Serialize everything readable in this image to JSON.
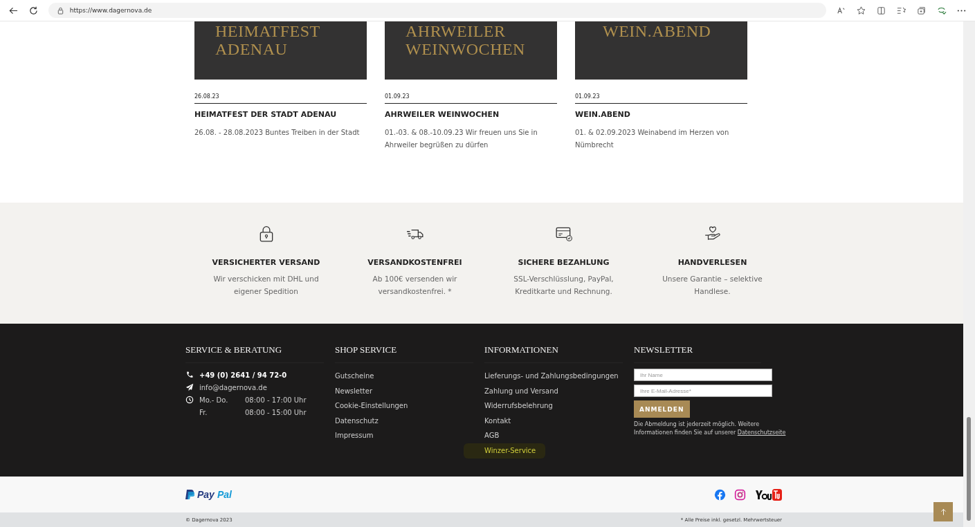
{
  "browser": {
    "url": "https://www.dagernova.de"
  },
  "events": [
    {
      "image_lines": [
        "HEIMATFEST",
        "ADENAU"
      ],
      "date": "26.08.23",
      "title": "HEIMATFEST DER STADT ADENAU",
      "text": "26.08. - 28.08.2023 Buntes Treiben in der Stadt"
    },
    {
      "image_lines": [
        "AHRWEILER",
        "WEINWOCHEN"
      ],
      "date": "01.09.23",
      "title": "AHRWEILER WEINWOCHEN",
      "text": "01.-03. & 08.-10.09.23 Wir freuen uns Sie in Ahrweiler begrüßen zu dürfen"
    },
    {
      "image_lines": [
        "WEIN.ABEND"
      ],
      "date": "01.09.23",
      "title": "WEIN.ABEND",
      "text": "01. & 02.09.2023 Weinabend im Herzen von Nümbrecht"
    }
  ],
  "features": [
    {
      "kind": "lock",
      "title": "VERSICHERTER VERSAND",
      "text": "Wir verschicken mit DHL und eigener Spedition"
    },
    {
      "kind": "truck",
      "title": "VERSANDKOSTENFREI",
      "text": "Ab 100€ versenden wir versandkostenfrei. *"
    },
    {
      "kind": "card",
      "title": "SICHERE BEZAHLUNG",
      "text": "SSL-Verschlüsslung, PayPal, Kreditkarte und Rechnung."
    },
    {
      "kind": "hand",
      "title": "HANDVERLESEN",
      "text": "Unsere Garantie – selektive Handlese."
    }
  ],
  "footer": {
    "service": {
      "title": "SERVICE & BERATUNG",
      "phone": "+49 (0) 2641 / 94 72-0",
      "email": "info@dagernova.de",
      "hours": [
        [
          "Mo.- Do.",
          "08:00 - 17:00 Uhr"
        ],
        [
          "Fr.",
          "08:00 - 15:00 Uhr"
        ]
      ]
    },
    "shop": {
      "title": "SHOP SERVICE",
      "links": [
        {
          "label": "Gutscheine",
          "highlighted": false
        },
        {
          "label": "Newsletter",
          "highlighted": false
        },
        {
          "label": "Cookie-Einstellungen",
          "highlighted": false
        },
        {
          "label": "Datenschutz",
          "highlighted": false
        },
        {
          "label": "Impressum",
          "highlighted": false
        }
      ]
    },
    "info": {
      "title": "INFORMATIONEN",
      "links": [
        {
          "label": "Lieferungs- und Zahlungsbedingungen",
          "highlighted": false
        },
        {
          "label": "Zahlung und Versand",
          "highlighted": false
        },
        {
          "label": "Widerrufsbelehrung",
          "highlighted": false
        },
        {
          "label": "Kontakt",
          "highlighted": false
        },
        {
          "label": "AGB",
          "highlighted": false
        },
        {
          "label": "Winzer-Service",
          "highlighted": true
        }
      ]
    },
    "newsletter": {
      "title": "NEWSLETTER",
      "name_placeholder": "Ihr Name",
      "email_placeholder": "Ihre E-Mail-Adresse*",
      "button": "ANMELDEN",
      "note": "Die Abmeldung ist jederzeit möglich. Weitere Informationen finden Sie auf unserer ",
      "note_link": "Datenschutzseite"
    }
  },
  "payment": "PayPal",
  "copyright": "© Dagernova 2023",
  "tax_note": "* Alle Preise inkl. gesetzl. Mehrwertsteuer"
}
